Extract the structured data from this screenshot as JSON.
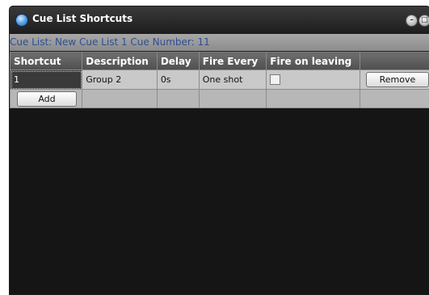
{
  "window": {
    "title": "Cue List Shortcuts",
    "info": "Cue List: New Cue List 1 Cue Number: 11"
  },
  "table": {
    "headers": [
      "Shortcut",
      "Description",
      "Delay",
      "Fire Every",
      "Fire on leaving",
      ""
    ],
    "rows": [
      {
        "shortcut": "1",
        "description": "Group 2",
        "delay": "0s",
        "fire_every": "One shot",
        "fire_on_leaving": false,
        "remove_label": "Remove"
      }
    ],
    "add_label": "Add"
  },
  "icons": {
    "app": "app-globe-icon",
    "window_buttons": [
      "minimize-icon",
      "maximize-icon",
      "close-icon"
    ]
  },
  "colors": {
    "window_bg": "#151515",
    "info_text": "#2e4f94",
    "header_bg": "#5c5c5c",
    "cell_bg": "#c9c9c9"
  }
}
